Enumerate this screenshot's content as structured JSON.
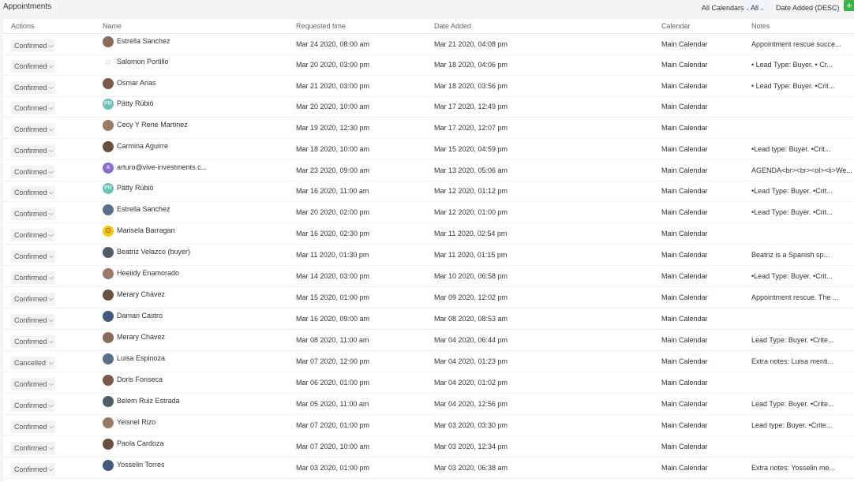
{
  "header": {
    "title": "Appointments",
    "filters": [
      "All Calendars",
      "All",
      "Date Added (DESC)"
    ],
    "add_label": "+"
  },
  "columns": [
    "Actions",
    "Name",
    "Requested time",
    "Date Added",
    "Calendar",
    "Notes"
  ],
  "rows": [
    {
      "status": "Confirmed",
      "name": "Estrella Sanchez",
      "requested": "Mar 24 2020, 08:00 am",
      "added": "Mar 21 2020, 04:08 pm",
      "calendar": "Main Calendar",
      "notes": "Appointment rescue succe...",
      "avatar": "photo"
    },
    {
      "status": "Confirmed",
      "name": "Salomon Portillo",
      "requested": "Mar 20 2020, 03:00 pm",
      "added": "Mar 18 2020, 04:06 pm",
      "calendar": "Main Calendar",
      "notes": "• Lead Type: Buyer. • Cr...",
      "avatar": "broken"
    },
    {
      "status": "Confirmed",
      "name": "Osmar Arias",
      "requested": "Mar 21 2020, 03:00 pm",
      "added": "Mar 18 2020, 03:56 pm",
      "calendar": "Main Calendar",
      "notes": "• Lead Type: Buyer. •Crit...",
      "avatar": "photo"
    },
    {
      "status": "Confirmed",
      "name": "Pätty Rübiö",
      "requested": "Mar 20 2020, 10:00 am",
      "added": "Mar 17 2020, 12:49 pm",
      "calendar": "Main Calendar",
      "notes": "",
      "avatar": "PR"
    },
    {
      "status": "Confirmed",
      "name": "Cecy Y Rene Martinez",
      "requested": "Mar 19 2020, 12:30 pm",
      "added": "Mar 17 2020, 12:07 pm",
      "calendar": "Main Calendar",
      "notes": "",
      "avatar": "photo"
    },
    {
      "status": "Confirmed",
      "name": "Carmina Aguirre",
      "requested": "Mar 18 2020, 10:00 am",
      "added": "Mar 15 2020, 04:59 pm",
      "calendar": "Main Calendar",
      "notes": "•Lead type: Buyer. •Crit...",
      "avatar": "photo"
    },
    {
      "status": "Confirmed",
      "name": "arturo@vive-investments.c...",
      "requested": "Mar 23 2020, 09:00 am",
      "added": "Mar 13 2020, 05:06 am",
      "calendar": "Main Calendar",
      "notes": "AGENDA<br><br><ol><li>We...",
      "avatar": "A"
    },
    {
      "status": "Confirmed",
      "name": "Pätty Rübiö",
      "requested": "Mar 16 2020, 11:00 am",
      "added": "Mar 12 2020, 01:12 pm",
      "calendar": "Main Calendar",
      "notes": "•Lead Type: Buyer. •Crit...",
      "avatar": "PR"
    },
    {
      "status": "Confirmed",
      "name": "Estrella Sanchez",
      "requested": "Mar 20 2020, 02:00 pm",
      "added": "Mar 12 2020, 01:00 pm",
      "calendar": "Main Calendar",
      "notes": "•Lead Type: Buyer. •Crit...",
      "avatar": "photo"
    },
    {
      "status": "Confirmed",
      "name": "Marisela Barragan",
      "requested": "Mar 16 2020, 02:30 pm",
      "added": "Mar 11 2020, 02:54 pm",
      "calendar": "Main Calendar",
      "notes": "",
      "avatar": "smiley"
    },
    {
      "status": "Confirmed",
      "name": "Beatriz Velazco (buyer)",
      "requested": "Mar 11 2020, 01:30 pm",
      "added": "Mar 11 2020, 01:15 pm",
      "calendar": "Main Calendar",
      "notes": "Beatriz is a Spanish sp...",
      "avatar": "photo"
    },
    {
      "status": "Confirmed",
      "name": "Heeiidy Enamorado",
      "requested": "Mar 14 2020, 03:00 pm",
      "added": "Mar 10 2020, 06:58 pm",
      "calendar": "Main Calendar",
      "notes": "•Lead Type: Buyer. •Crit...",
      "avatar": "photo"
    },
    {
      "status": "Confirmed",
      "name": "Merary Chavez",
      "requested": "Mar 15 2020, 01:00 pm",
      "added": "Mar 09 2020, 12:02 pm",
      "calendar": "Main Calendar",
      "notes": "Appointment rescue. The ...",
      "avatar": "photo"
    },
    {
      "status": "Confirmed",
      "name": "Damari Castro",
      "requested": "Mar 16 2020, 09:00 am",
      "added": "Mar 08 2020, 08:53 am",
      "calendar": "Main Calendar",
      "notes": "",
      "avatar": "photo"
    },
    {
      "status": "Confirmed",
      "name": "Merary Chavez",
      "requested": "Mar 08 2020, 11:00 am",
      "added": "Mar 04 2020, 06:44 pm",
      "calendar": "Main Calendar",
      "notes": "Lead Type: Buyer. •Crite...",
      "avatar": "photo"
    },
    {
      "status": "Cancelled",
      "name": "Luisa Espinoza",
      "requested": "Mar 07 2020, 12:00 pm",
      "added": "Mar 04 2020, 01:23 pm",
      "calendar": "Main Calendar",
      "notes": "Extra notes: Luisa menti...",
      "avatar": "photo"
    },
    {
      "status": "Confirmed",
      "name": "Doris Fonseca",
      "requested": "Mar 06 2020, 01:00 pm",
      "added": "Mar 04 2020, 01:02 pm",
      "calendar": "Main Calendar",
      "notes": "",
      "avatar": "photo"
    },
    {
      "status": "Confirmed",
      "name": "Belem Ruiz Estrada",
      "requested": "Mar 05 2020, 11:00 am",
      "added": "Mar 04 2020, 12:56 pm",
      "calendar": "Main Calendar",
      "notes": "Lead Type: Buyer. •Crite...",
      "avatar": "photo"
    },
    {
      "status": "Confirmed",
      "name": "Yeisnel Rizo",
      "requested": "Mar 07 2020, 01:00 pm",
      "added": "Mar 03 2020, 03:30 pm",
      "calendar": "Main Calendar",
      "notes": "Lead type: Buyer. •Crite...",
      "avatar": "photo"
    },
    {
      "status": "Confirmed",
      "name": "Paola Cardoza",
      "requested": "Mar 07 2020, 10:00 am",
      "added": "Mar 03 2020, 12:34 pm",
      "calendar": "Main Calendar",
      "notes": "",
      "avatar": "photo"
    },
    {
      "status": "Confirmed",
      "name": "Yosselin Torres",
      "requested": "Mar 03 2020, 01:00 pm",
      "added": "Mar 03 2020, 06:38 am",
      "calendar": "Main Calendar",
      "notes": "Extra notes: Yosselin me...",
      "avatar": "photo"
    }
  ],
  "colors": {
    "accent": "#4a90e2",
    "add_button": "#38b34a",
    "pr_avatar": "#6cc2b6",
    "a_avatar": "#8e6ad8",
    "smiley": "#f5c518"
  }
}
